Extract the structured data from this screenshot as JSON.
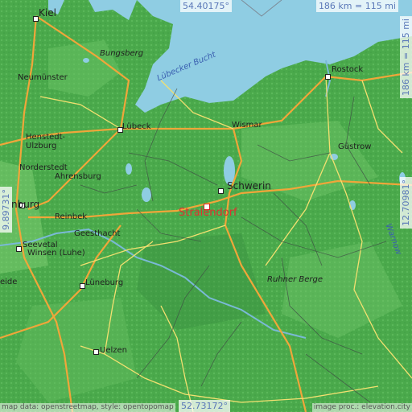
{
  "scale_top": "186 km = 115 mi",
  "scale_right": "186 km = 115 mi",
  "lat_top": "54.40175°",
  "lat_bottom": "52.73172°",
  "lon_left": "9.89731°",
  "lon_right": "12.70981°",
  "attribution_left": "map data: openstreetmap, style: opentopomap",
  "attribution_right": "image proc.: elevation.city",
  "target": "Stralendorf",
  "water_labels": {
    "bay": "Lübecker Bucht"
  },
  "places": {
    "kiel": "Kiel",
    "rostock": "Rostock",
    "bungsberg": "Bungsberg",
    "neumunster": "Neumünster",
    "lubeck": "Lübeck",
    "wismar": "Wismar",
    "gustrow": "Güstrow",
    "henstedt": "Henstedt-",
    "ulzburg": "Ulzburg",
    "norderstedt": "Norderstedt",
    "ahrensburg": "Ahrensburg",
    "schwerin": "Schwerin",
    "hamburg": "nburg",
    "reinbek": "Reinbek",
    "geesthacht": "Geesthacht",
    "seevetal": "Seevetal",
    "winsen": "Winsen (Luhe)",
    "heide": "eide",
    "luneburg": "Lüneburg",
    "ruhner": "Ruhner Berge",
    "uelzen": "Uelzen",
    "rostock_river": "Warnow"
  }
}
